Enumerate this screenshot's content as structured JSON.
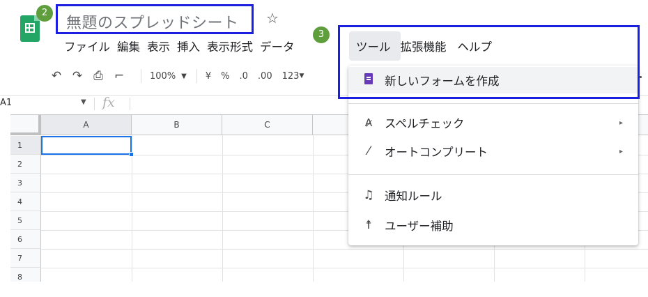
{
  "header": {
    "doc_title": "無題のスプレッドシート",
    "step_badges": [
      "2",
      "3"
    ],
    "icons": {
      "logo": "sheets-logo-icon",
      "star": "star-outline-icon"
    }
  },
  "menubar": {
    "items": [
      "ファイル",
      "編集",
      "表示",
      "挿入",
      "表示形式",
      "データ",
      "ツール",
      "拡張機能",
      "ヘルプ"
    ],
    "active": "ツール"
  },
  "toolbar": {
    "zoom": "100%",
    "currency": "¥",
    "percent": "%",
    "decrease_decimal": ".0",
    "increase_decimal": ".00",
    "more_formats": "123",
    "icons": [
      "undo-icon",
      "redo-icon",
      "print-icon",
      "paint-format-icon"
    ]
  },
  "formula_bar": {
    "cell_ref": "A1",
    "fx": "fx"
  },
  "grid": {
    "columns": [
      "A",
      "B",
      "C"
    ],
    "rows": [
      "1",
      "2",
      "3",
      "4",
      "5",
      "6",
      "7",
      "8"
    ],
    "active_cell": "A1"
  },
  "tools_menu": {
    "items": [
      {
        "label": "新しいフォームを作成",
        "icon": "google-forms-icon",
        "submenu": false
      },
      {
        "label": "スペルチェック",
        "icon": "spellcheck-icon",
        "submenu": true
      },
      {
        "label": "オートコンプリート",
        "icon": "magic-wand-icon",
        "submenu": true
      },
      {
        "label": "通知ルール",
        "icon": "bell-icon",
        "submenu": false
      },
      {
        "label": "ユーザー補助",
        "icon": "accessibility-icon",
        "submenu": false
      }
    ],
    "submenu_arrow": "▸"
  },
  "colors": {
    "highlight_border": "#1a1fe0",
    "badge": "#5f9e3c",
    "sheets_green": "#23a566",
    "forms_purple": "#673ab7",
    "selection_blue": "#1a73e8"
  }
}
